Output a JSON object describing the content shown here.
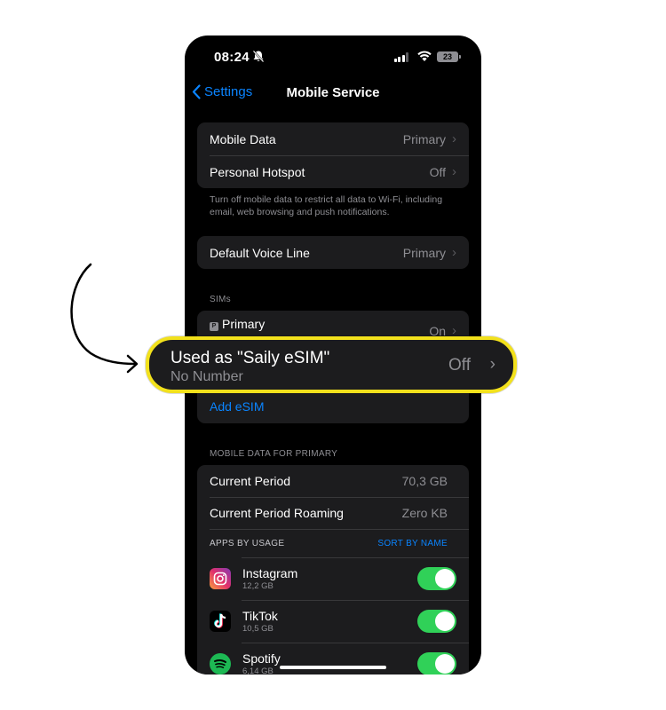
{
  "status_bar": {
    "time": "08:24",
    "battery": "23"
  },
  "nav": {
    "back_label": "Settings",
    "title": "Mobile Service"
  },
  "mobile_group": {
    "rows": [
      {
        "label": "Mobile Data",
        "value": "Primary"
      },
      {
        "label": "Personal Hotspot",
        "value": "Off"
      }
    ],
    "footer": "Turn off mobile data to restrict all data to Wi-Fi, including email, web browsing and push notifications."
  },
  "voice_group": {
    "label": "Default Voice Line",
    "value": "Primary"
  },
  "sims": {
    "header": "SIMs",
    "primary_badge": "P",
    "primary_label": "Primary",
    "primary_value": "On",
    "add_esim": "Add eSIM"
  },
  "callout": {
    "title": "Used as \"Saily eSIM\"",
    "subtitle": "No Number",
    "value": "Off"
  },
  "data_section": {
    "header": "MOBILE DATA FOR PRIMARY",
    "rows": [
      {
        "label": "Current Period",
        "value": "70,3 GB"
      },
      {
        "label": "Current Period Roaming",
        "value": "Zero KB"
      }
    ],
    "apps_header": "APPS BY USAGE",
    "sort_label": "SORT BY NAME",
    "apps": [
      {
        "name": "Instagram",
        "size": "12,2 GB",
        "icon": "instagram-icon",
        "enabled": true
      },
      {
        "name": "TikTok",
        "size": "10,5 GB",
        "icon": "tiktok-icon",
        "enabled": true
      },
      {
        "name": "Spotify",
        "size": "6,14 GB",
        "icon": "spotify-icon",
        "enabled": true
      }
    ]
  },
  "colors": {
    "accent": "#0a84ff",
    "toggle_on": "#30d158",
    "highlight": "#f2e11c"
  }
}
